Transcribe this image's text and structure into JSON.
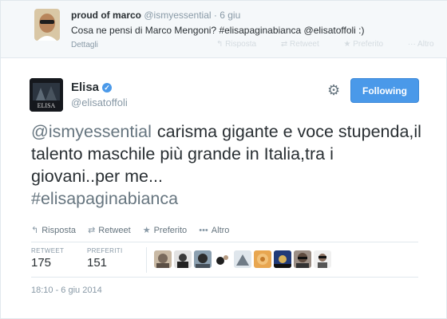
{
  "parent_tweet": {
    "name": "proud of marco",
    "handle": "@ismyessential",
    "time": "· 6 giu",
    "text": "Cosa ne pensi di Marco Mengoni? #elisapaginabianca @elisatoffoli :)",
    "details_label": "Dettagli",
    "actions": [
      "Risposta",
      "Retweet",
      "Preferito",
      "Altro"
    ]
  },
  "tweet": {
    "name": "Elisa",
    "handle": "@elisatoffoli",
    "avatar_label": "ELISA",
    "follow_label": "Following",
    "mention": "@ismyessential",
    "text": "carisma gigante e voce stupenda,il talento maschile più grande in Italia,tra i giovani..per me...",
    "hashtag": "#elisapaginabianca",
    "actions": {
      "reply": "Risposta",
      "retweet": "Retweet",
      "favorite": "Preferito",
      "more": "Altro"
    },
    "stats": {
      "retweets_label": "RETWEET",
      "retweets": "175",
      "favorites_label": "PREFERITI",
      "favorites": "151"
    },
    "date": "18:10 - 6 giu 2014"
  },
  "icons": {
    "verified": "verified-badge-icon",
    "gear": "gear-icon",
    "reply": "reply-arrow-icon",
    "retweet": "retweet-icon",
    "favorite": "star-icon",
    "more": "ellipsis-icon"
  },
  "colors": {
    "accent": "#4a99e9",
    "text": "#292f33",
    "muted": "#8899a6",
    "border": "#e1e8ed"
  }
}
